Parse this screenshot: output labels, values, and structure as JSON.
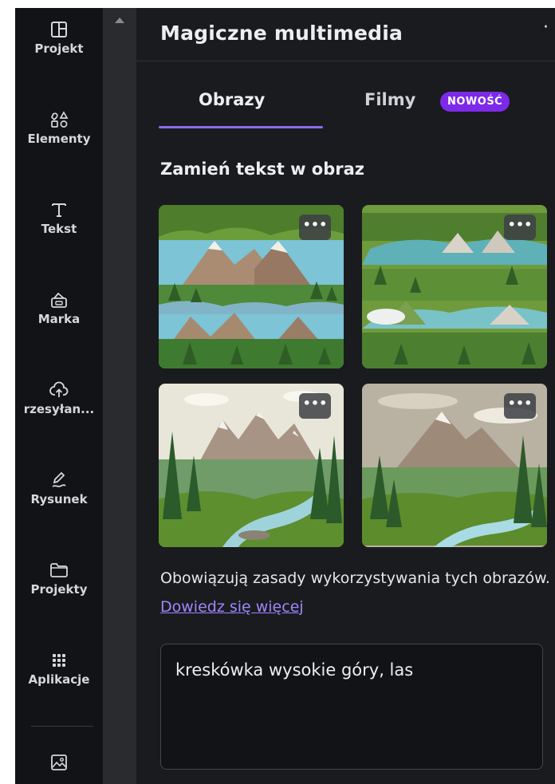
{
  "sidebar": {
    "items": [
      {
        "label": "Projekt",
        "icon": "layout-icon"
      },
      {
        "label": "Elementy",
        "icon": "shapes-icon"
      },
      {
        "label": "Tekst",
        "icon": "text-icon"
      },
      {
        "label": "Marka",
        "icon": "brand-icon"
      },
      {
        "label": "rzesyłan...",
        "icon": "upload-icon"
      },
      {
        "label": "Rysunek",
        "icon": "draw-icon"
      },
      {
        "label": "Projekty",
        "icon": "folder-icon"
      },
      {
        "label": "Aplikacje",
        "icon": "apps-icon"
      }
    ],
    "bottom_icon": "image-icon"
  },
  "panel": {
    "title": "Magiczne multimedia",
    "more_label": "·",
    "tabs": [
      {
        "label": "Obrazy",
        "active": true
      },
      {
        "label": "Filmy",
        "active": false
      }
    ],
    "badge": "NOWOŚĆ",
    "section_heading": "Zamień tekst w obraz",
    "thumb_more": "•••",
    "policy_text": "Obowiązują zasady wykorzystywania tych obrazów.",
    "policy_link": "Dowiedz się więcej",
    "prompt_value": "kreskówka wysokie góry, las"
  },
  "colors": {
    "accent": "#7d2ae8",
    "tab_indicator": "#8b6cf0",
    "link": "#9f86ff",
    "panel_bg": "#1a1b1e",
    "rail_bg": "#121316"
  }
}
